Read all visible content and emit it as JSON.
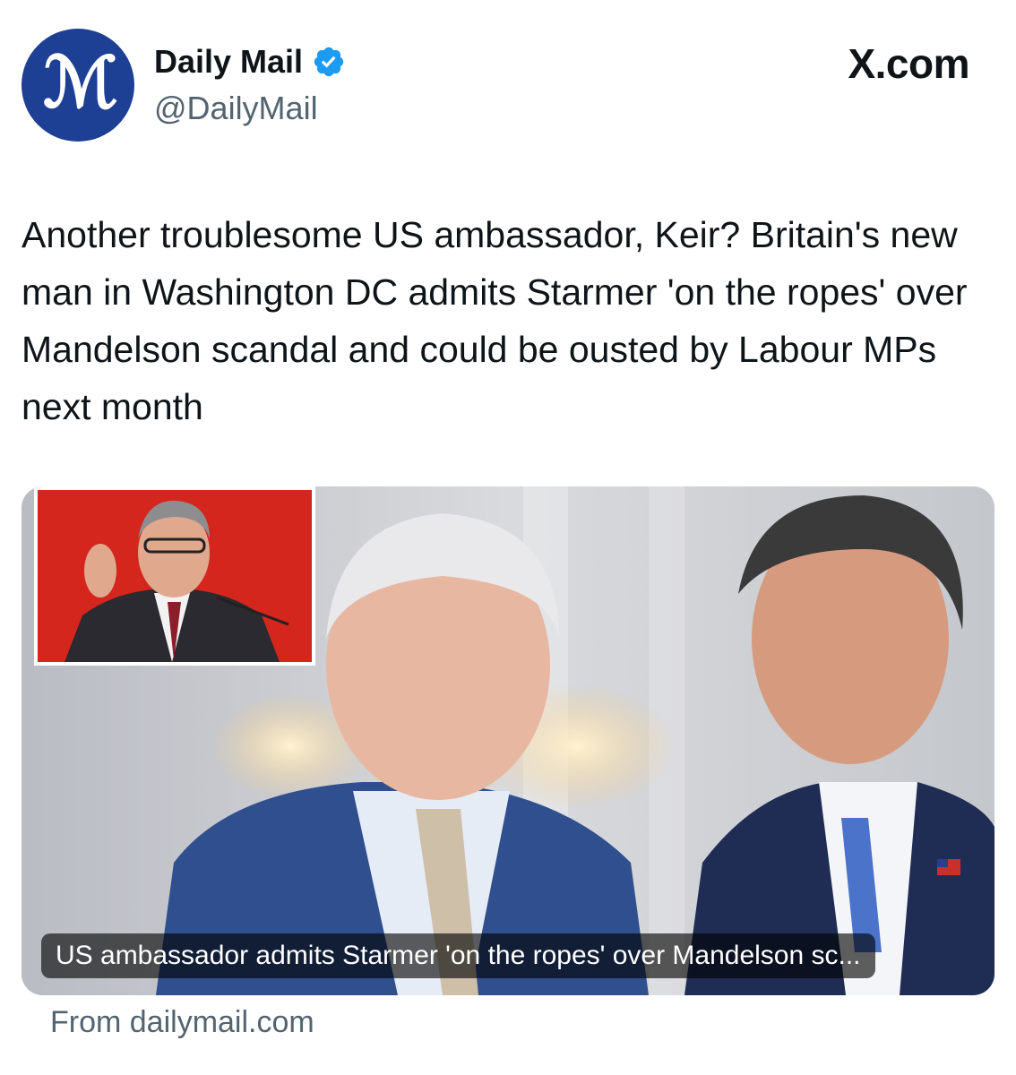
{
  "author": {
    "avatar_letters": "M",
    "display_name": "Daily Mail",
    "handle": "@DailyMail",
    "verified": true
  },
  "brand": {
    "label": "X.com"
  },
  "post": {
    "text": "Another troublesome US ambassador, Keir? Britain's new man in Washington DC admits Starmer 'on the ropes' over Mandelson scandal and could be ousted by Labour MPs next month"
  },
  "card": {
    "caption": "US ambassador admits Starmer 'on the ropes' over Mandelson sc...",
    "source": "From dailymail.com"
  },
  "colors": {
    "avatar_bg": "#1d3f94",
    "verified_badge": "#1d9bf0",
    "secondary_text": "#536471",
    "inset_background": "#d5261d"
  }
}
